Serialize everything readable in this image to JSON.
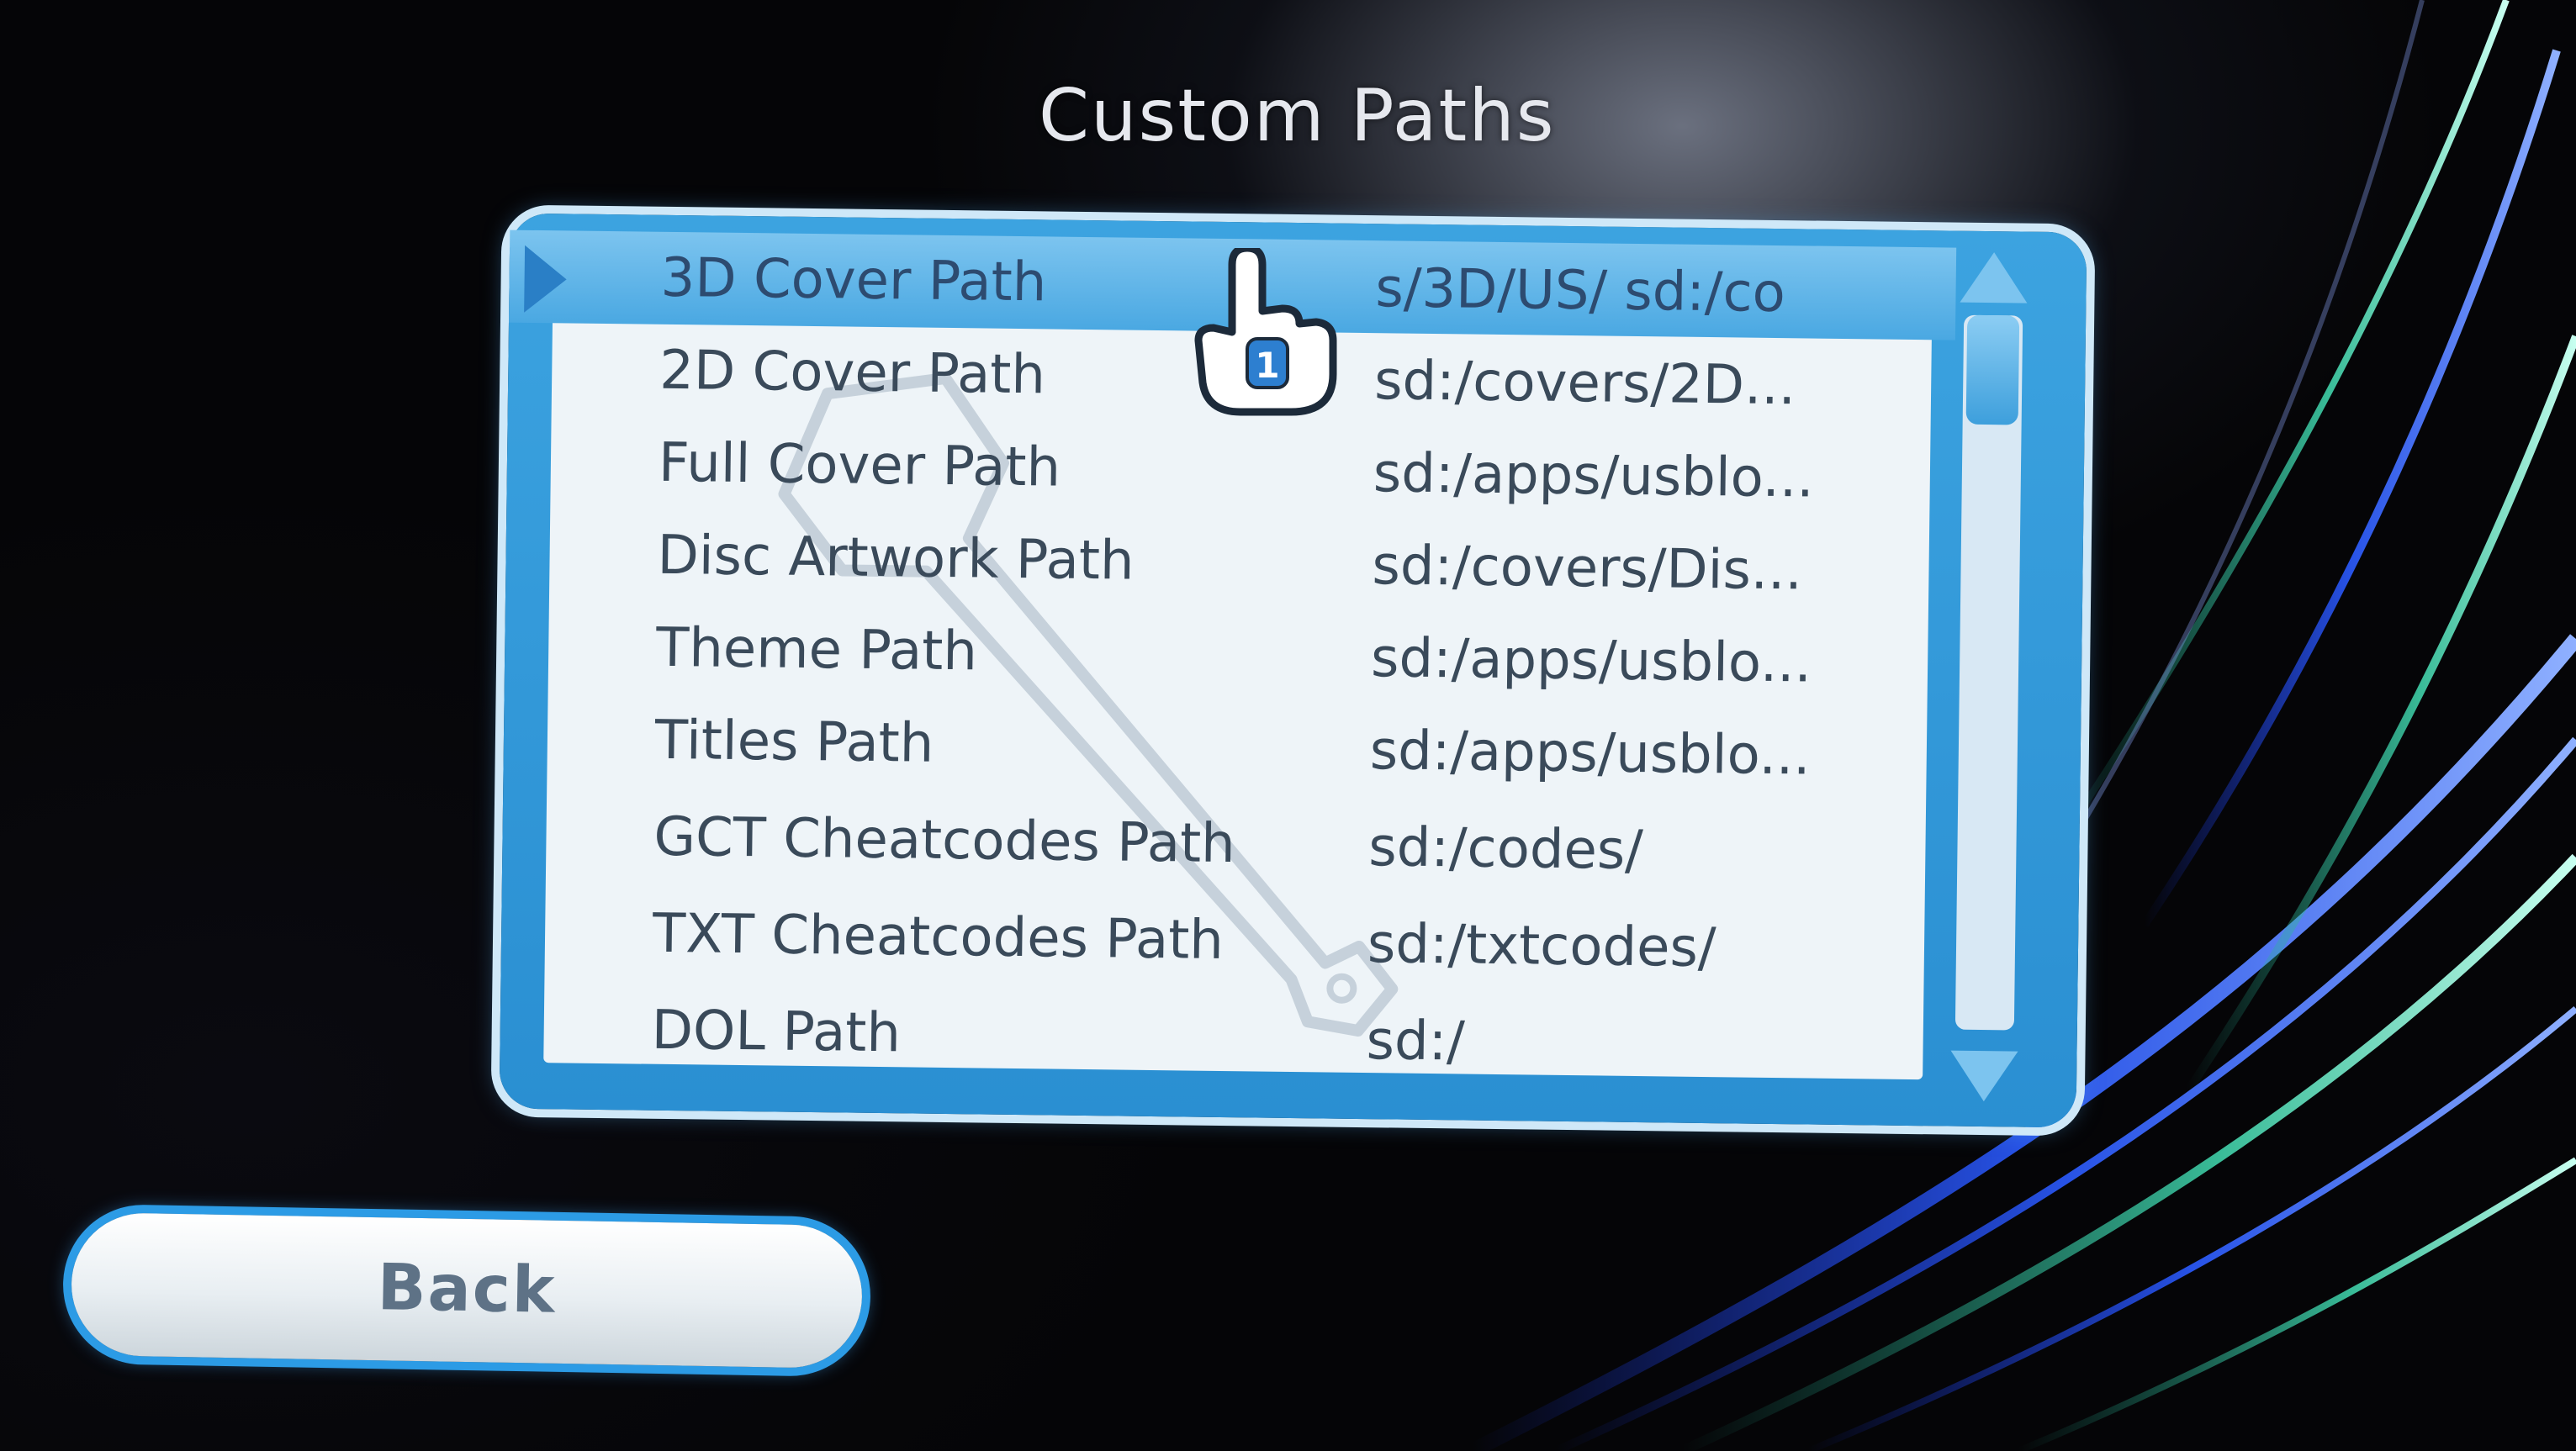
{
  "screen": {
    "title": "Custom Paths"
  },
  "path_list": {
    "items": [
      {
        "name": "3D Cover Path",
        "value": "s/3D/US/   sd:/co",
        "selected": true
      },
      {
        "name": "2D Cover Path",
        "value": "sd:/covers/2D..."
      },
      {
        "name": "Full Cover Path",
        "value": "sd:/apps/usblo..."
      },
      {
        "name": "Disc Artwork Path",
        "value": "sd:/covers/Dis..."
      },
      {
        "name": "Theme Path",
        "value": "sd:/apps/usblo..."
      },
      {
        "name": "Titles Path",
        "value": "sd:/apps/usblo..."
      },
      {
        "name": "GCT Cheatcodes Path",
        "value": "sd:/codes/"
      },
      {
        "name": "TXT Cheatcodes Path",
        "value": "sd:/txtcodes/"
      },
      {
        "name": "DOL Path",
        "value": "sd:/"
      }
    ]
  },
  "pointer": {
    "icon": "hand-pointer-icon",
    "player_number": "1"
  },
  "back_button": {
    "label": "Back"
  },
  "colors": {
    "panel_blue": "#2a8fd2",
    "selection_blue": "#4aa8e2",
    "button_glow": "#2c9be5"
  }
}
